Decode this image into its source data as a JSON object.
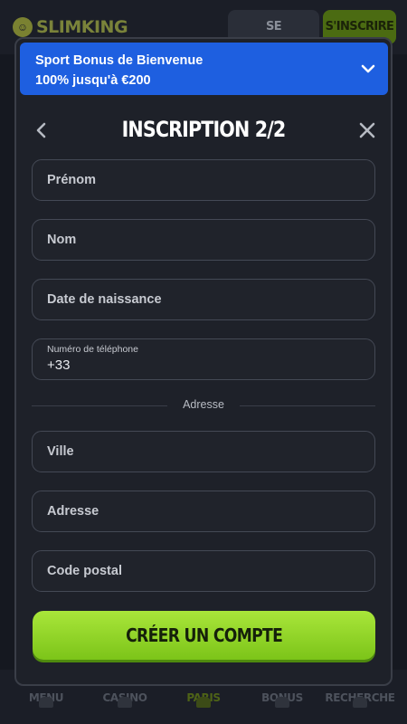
{
  "header": {
    "logo_text": "SLIMKING",
    "login_label": "SE CONNECTER",
    "signup_label": "S'INSCRIRE"
  },
  "bottom_nav": {
    "items": [
      {
        "label": "MENU",
        "active": false
      },
      {
        "label": "CASINO",
        "active": false
      },
      {
        "label": "PARIS",
        "active": true
      },
      {
        "label": "BONUS",
        "active": false
      },
      {
        "label": "RECHERCHE",
        "active": false
      }
    ]
  },
  "modal": {
    "promo": {
      "line1": "Sport Bonus de Bienvenue",
      "line2": "100% jusqu'à €200",
      "icon": "chevron-down-icon",
      "color": "#1e5fe0"
    },
    "title": "INSCRIPTION 2/2",
    "back_icon": "chevron-left-icon",
    "close_icon": "close-icon",
    "fields": {
      "first_name": {
        "placeholder": "Prénom"
      },
      "last_name": {
        "placeholder": "Nom"
      },
      "birth_date": {
        "placeholder": "Date de naissance"
      },
      "phone": {
        "label": "Numéro de téléphone",
        "value": "+33"
      },
      "city": {
        "placeholder": "Ville"
      },
      "address": {
        "placeholder": "Adresse"
      },
      "postal_code": {
        "placeholder": "Code postal"
      }
    },
    "section_divider": "Adresse",
    "submit_label": "CRÉER UN COMPTE",
    "accent_color": "#8fd42a"
  }
}
